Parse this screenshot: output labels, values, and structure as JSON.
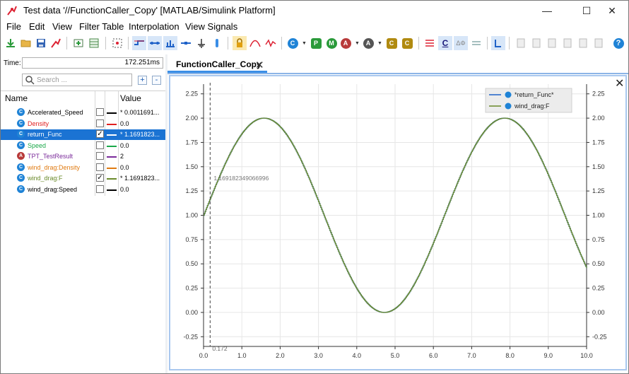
{
  "window": {
    "title": "Test data '//FunctionCaller_Copy' [MATLAB/Simulink Platform]",
    "app_icon": "tpt-icon",
    "minimize": "—",
    "maximize": "☐",
    "close": "✕"
  },
  "menu": [
    "File",
    "Edit",
    "View",
    "Filter Table",
    "Interpolation",
    "View Signals"
  ],
  "toolbar": {
    "letters": {
      "c1": "C",
      "p": "P",
      "m": "M",
      "a1": "A",
      "a2": "A",
      "c2": "C",
      "c3": "C",
      "c4": "C",
      "delta": "ΔΦ"
    }
  },
  "left_panel": {
    "time_label": "Time:",
    "time_value": "172.251ms",
    "search_placeholder": "Search ...",
    "add_label": "+",
    "remove_label": "-",
    "col_name": "Name",
    "col_value": "Value",
    "signals": [
      {
        "name": "Accelerated_Speed",
        "color": "#000000",
        "icon": "C",
        "icon_color": "#1f83d6",
        "checked": false,
        "value": "* 0.0011691...",
        "selected": false
      },
      {
        "name": "Density",
        "color": "#e02020",
        "icon": "C",
        "icon_color": "#1f83d6",
        "checked": false,
        "value": "0.0",
        "selected": false
      },
      {
        "name": "return_Func",
        "color": "#1f62c8",
        "icon": "C",
        "icon_color": "#1f83d6",
        "checked": true,
        "value": "* 1.1691823...",
        "selected": true
      },
      {
        "name": "Speed",
        "color": "#1aa84a",
        "icon": "C",
        "icon_color": "#1f83d6",
        "checked": false,
        "value": "0.0",
        "selected": false
      },
      {
        "name": "TPT_TestResult",
        "color": "#7a2a9a",
        "icon": "A",
        "icon_color": "#b83a3a",
        "checked": false,
        "value": "2",
        "selected": false
      },
      {
        "name": "wind_drag:Density",
        "color": "#e07a10",
        "icon": "C",
        "icon_color": "#1f83d6",
        "checked": false,
        "value": "0.0",
        "selected": false
      },
      {
        "name": "wind_drag:F",
        "color": "#6a8a2a",
        "icon": "C",
        "icon_color": "#1f83d6",
        "checked": true,
        "value": "* 1.1691823...",
        "selected": false
      },
      {
        "name": "wind_drag:Speed",
        "color": "#000000",
        "icon": "C",
        "icon_color": "#1f83d6",
        "checked": false,
        "value": "0.0",
        "selected": false
      }
    ]
  },
  "tab": {
    "label": "FunctionCaller_Copy",
    "close": "✕"
  },
  "plot_close": "✕",
  "chart_data": {
    "type": "line",
    "title": "",
    "xlim": [
      0.0,
      10.0
    ],
    "ylim": [
      -0.35,
      2.35
    ],
    "x_ticks": [
      "0.0",
      "1.0",
      "2.0",
      "3.0",
      "4.0",
      "5.0",
      "6.0",
      "7.0",
      "8.0",
      "9.0",
      "10.0"
    ],
    "y_ticks": [
      "-0.25",
      "0.00",
      "0.25",
      "0.50",
      "0.75",
      "1.00",
      "1.25",
      "1.50",
      "1.75",
      "2.00",
      "2.25"
    ],
    "cursor_x": 0.172,
    "cursor_label": "0.172",
    "cursor_value_label": "1.169182349066996",
    "grid": true,
    "legend_position": "top-right",
    "series": [
      {
        "name": "*return_Func*",
        "color": "#1f62c8",
        "function": "1 + sin(x)",
        "x_start": 0.0,
        "x_end": 10.0,
        "step": 0.02
      },
      {
        "name": "wind_drag:F",
        "color": "#6a8a2a",
        "function": "1 + sin(x)",
        "x_start": 0.0,
        "x_end": 10.0,
        "step": 0.02
      }
    ]
  }
}
